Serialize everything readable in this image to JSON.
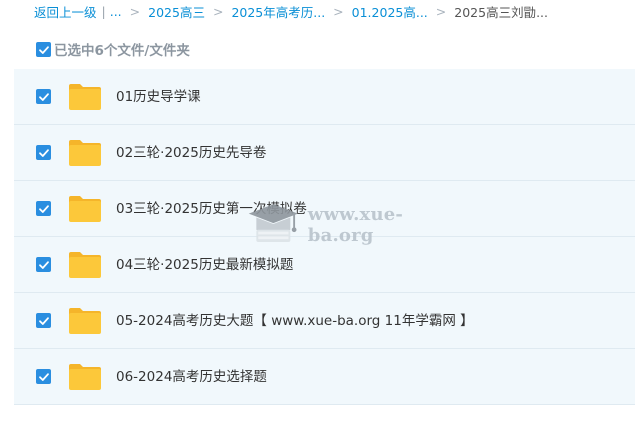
{
  "breadcrumb": {
    "back": "返回上一级",
    "ellipsis": "...",
    "items": [
      "2025高三",
      "2025年高考历...",
      "01.2025高...",
      "2025高三刘勖..."
    ]
  },
  "header": {
    "selected_label": "已选中6个文件/文件夹"
  },
  "files": [
    {
      "name": "01历史导学课"
    },
    {
      "name": "02三轮·2025历史先导卷"
    },
    {
      "name": "03三轮·2025历史第一次模拟卷"
    },
    {
      "name": "04三轮·2025历史最新模拟题"
    },
    {
      "name": "05-2024高考历史大题【 www.xue-ba.org 11年学霸网 】"
    },
    {
      "name": "06-2024高考历史选择题"
    }
  ],
  "watermark": {
    "text": "www.xue-ba.org"
  },
  "colors": {
    "accent": "#2a8ee0",
    "link": "#0a8fd6",
    "row_bg": "#f1f8fc",
    "folder": "#fcc83a"
  }
}
